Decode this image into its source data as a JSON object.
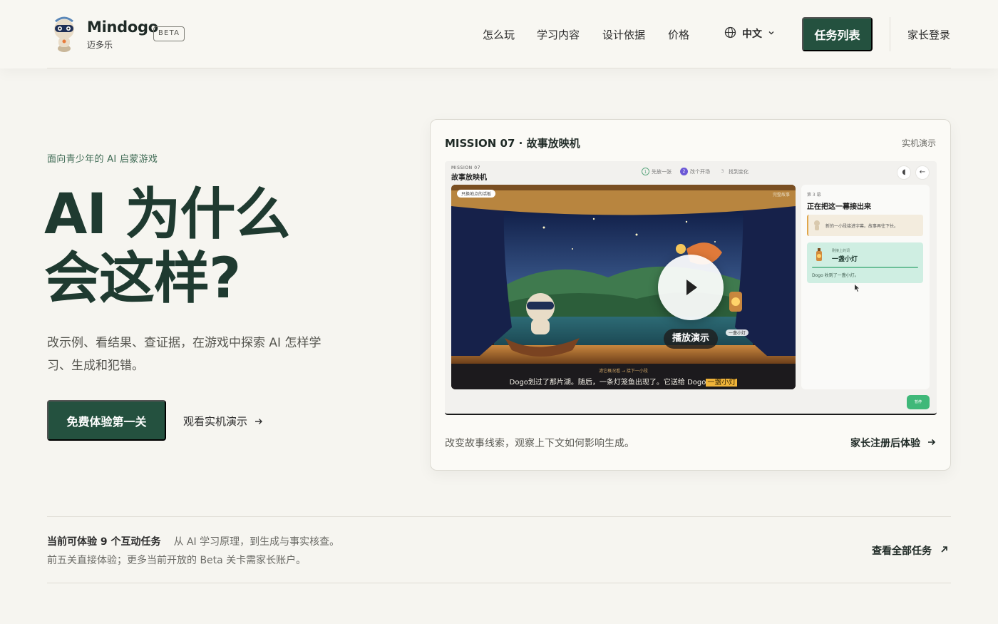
{
  "header": {
    "brand_name": "Mindogo",
    "brand_sub": "迈多乐",
    "beta": "BETA",
    "nav": [
      "怎么玩",
      "学习内容",
      "设计依据",
      "价格"
    ],
    "language": "中文",
    "task_list_label": "任务列表",
    "parent_login_label": "家长登录"
  },
  "hero": {
    "eyebrow": "面向青少年的 AI 启蒙游戏",
    "title_line1": "AI 为什么",
    "title_line2": "会这样?",
    "description": "改示例、看结果、查证据，在游戏中探索 AI 怎样学习、生成和犯错。",
    "cta_label": "免费体验第一关",
    "demo_link_label": "观看实机演示"
  },
  "demo_card": {
    "title": "MISSION 07 · 故事放映机",
    "tag": "实机演示",
    "screen": {
      "mission": "MISSION 07",
      "title": "故事放映机",
      "steps": [
        "先放一张",
        "改个开场",
        "找到变化"
      ],
      "stage_chip": "只换地点的活板",
      "stage_chip_right": "完整故事",
      "play_label": "播放演示",
      "mini_chip": "一盏小灯",
      "caption_sub": "滤它概况看 → 接下一小段",
      "caption_text": "Dogo划过了那片湖。随后，一条灯笼鱼出现了。它送给 Dogo",
      "caption_highlight": "一盏小灯",
      "side_label": "第 3 幕",
      "side_title": "正在把这一幕接出来",
      "side_card1_text": "新的一小段接进字幕。故事再往下长。",
      "side_card2_label": "刚接上的词",
      "side_card2_title": "一盏小灯",
      "side_card2_text": "Dogo 收到了一盏小灯。",
      "pause_label": "暂停"
    },
    "footer_text": "改变故事线索，观察上下文如何影响生成。",
    "footer_link": "家长注册后体验"
  },
  "strip": {
    "count_label": "当前可体验 9 个互动任务",
    "scope_label": "从 AI 学习原理，到生成与事实核查。",
    "note": "前五关直接体验；更多当前开放的 Beta 关卡需家长账户。",
    "all_tasks_label": "查看全部任务"
  },
  "colors": {
    "accent": "#24513f",
    "background": "#f6f5f0",
    "eyebrow": "#3f6b55"
  },
  "icons": [
    "robot-mascot-logo",
    "globe-icon",
    "chevron-down-icon",
    "arrow-right-icon",
    "arrow-up-right-icon",
    "play-icon"
  ]
}
